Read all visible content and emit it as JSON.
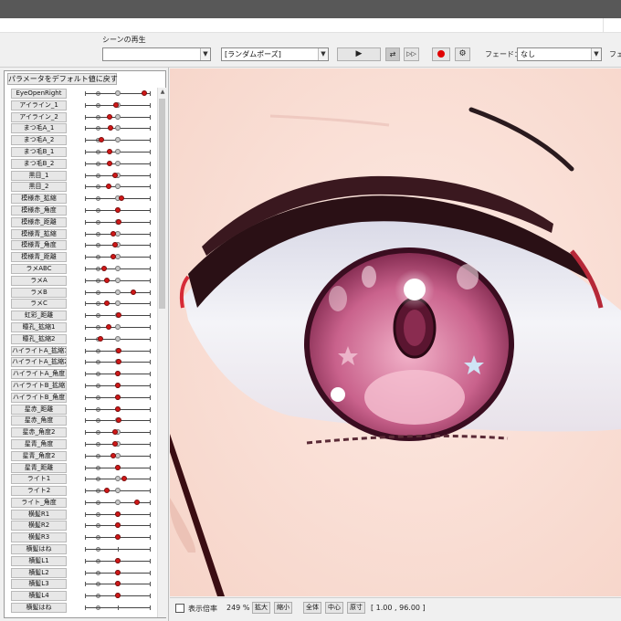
{
  "toolbar": {
    "scene_label": "シーンの再生",
    "scene_value": "",
    "pose_value": "[ランダムポーズ]",
    "play_icon": "play-icon",
    "loop_icon": "loop-icon",
    "skip_icon": "skip-forward-icon",
    "record_icon": "record-icon",
    "settings_icon": "gear-icon",
    "fade_label": "フェード：",
    "fade_value": "なし",
    "fade_label_cut": "フェ",
    "record_color": "#e00000"
  },
  "panel": {
    "reset_label": "パラメータをデフォルト値に戻す",
    "params": [
      {
        "name": "EyeOpenRight",
        "value": 0.92
      },
      {
        "name": "アイライン_1",
        "value": 0.48
      },
      {
        "name": "アイライン_2",
        "value": 0.38
      },
      {
        "name": "まつ毛A_1",
        "value": 0.4
      },
      {
        "name": "まつ毛A_2",
        "value": 0.26
      },
      {
        "name": "まつ毛B_1",
        "value": 0.38
      },
      {
        "name": "まつ毛B_2",
        "value": 0.38
      },
      {
        "name": "黒目_1",
        "value": 0.46
      },
      {
        "name": "黒目_2",
        "value": 0.36
      },
      {
        "name": "模様赤_拡縮",
        "value": 0.56
      },
      {
        "name": "模様赤_角度",
        "value": 0.5
      },
      {
        "name": "模様赤_距離",
        "value": 0.52
      },
      {
        "name": "模様青_拡縮",
        "value": 0.44
      },
      {
        "name": "模様青_角度",
        "value": 0.47
      },
      {
        "name": "模様青_距離",
        "value": 0.44
      },
      {
        "name": "ラメABC",
        "value": 0.3
      },
      {
        "name": "ラメA",
        "value": 0.34
      },
      {
        "name": "ラメB",
        "value": 0.74
      },
      {
        "name": "ラメC",
        "value": 0.34
      },
      {
        "name": "虹彩_距離",
        "value": 0.52
      },
      {
        "name": "瞳孔_拡縮1",
        "value": 0.36
      },
      {
        "name": "瞳孔_拡縮2",
        "value": 0.24
      },
      {
        "name": "ハイライトA_拡縮1",
        "value": 0.52
      },
      {
        "name": "ハイライトA_拡縮2",
        "value": 0.52
      },
      {
        "name": "ハイライトA_角度",
        "value": 0.5
      },
      {
        "name": "ハイライトB_拡縮",
        "value": 0.5
      },
      {
        "name": "ハイライトB_角度",
        "value": 0.5
      },
      {
        "name": "星赤_距離",
        "value": 0.5
      },
      {
        "name": "星赤_角度",
        "value": 0.52
      },
      {
        "name": "星赤_角度2",
        "value": 0.46
      },
      {
        "name": "星青_角度",
        "value": 0.46
      },
      {
        "name": "星青_角度2",
        "value": 0.44
      },
      {
        "name": "星青_距離",
        "value": 0.5
      },
      {
        "name": "ライト1",
        "value": 0.6
      },
      {
        "name": "ライト2",
        "value": 0.34
      },
      {
        "name": "ライト_角度",
        "value": 0.8
      },
      {
        "name": "横髪R1",
        "value": 0.5
      },
      {
        "name": "横髪R2",
        "value": 0.5
      },
      {
        "name": "横髪R3",
        "value": 0.5
      },
      {
        "name": "横髪はね",
        "value": null
      },
      {
        "name": "横髪L1",
        "value": 0.5
      },
      {
        "name": "横髪L2",
        "value": 0.5
      },
      {
        "name": "横髪L3",
        "value": 0.5
      },
      {
        "name": "横髪L4",
        "value": 0.5
      },
      {
        "name": "横髪はね",
        "value": null
      }
    ]
  },
  "status": {
    "display_label": "表示倍率",
    "zoom": "249 %",
    "zoom_in": "拡大",
    "zoom_out": "縮小",
    "fit_all": "全体",
    "center": "中心",
    "actual_size": "原寸",
    "coords": "[ 1.00 , 96.00 ]"
  }
}
